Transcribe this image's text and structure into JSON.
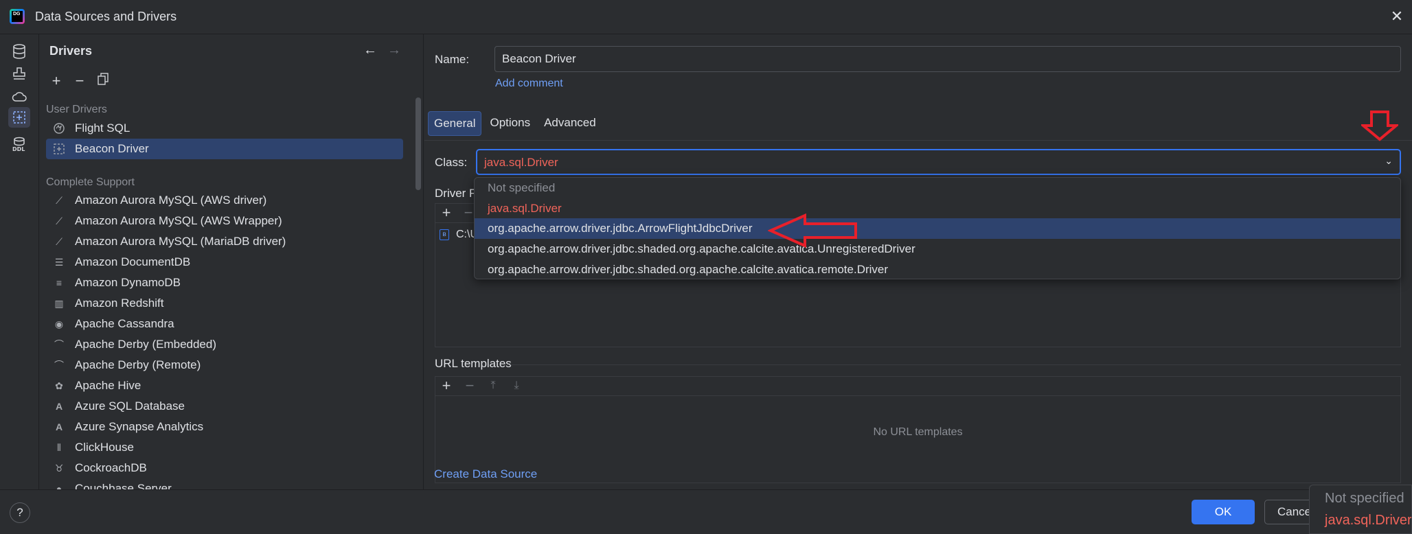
{
  "window": {
    "title": "Data Sources and Drivers"
  },
  "left_panel": {
    "title": "Drivers",
    "groups": [
      {
        "label": "User Drivers"
      },
      {
        "label": "Complete Support"
      }
    ],
    "user_drivers": [
      {
        "label": "Flight SQL",
        "icon": "flight-sql-icon"
      },
      {
        "label": "Beacon Driver",
        "icon": "driver-icon",
        "selected": true
      }
    ],
    "complete_support": [
      {
        "label": "Amazon Aurora MySQL (AWS driver)"
      },
      {
        "label": "Amazon Aurora MySQL (AWS Wrapper)"
      },
      {
        "label": "Amazon Aurora MySQL (MariaDB driver)"
      },
      {
        "label": "Amazon DocumentDB"
      },
      {
        "label": "Amazon DynamoDB"
      },
      {
        "label": "Amazon Redshift"
      },
      {
        "label": "Apache Cassandra"
      },
      {
        "label": "Apache Derby (Embedded)"
      },
      {
        "label": "Apache Derby (Remote)"
      },
      {
        "label": "Apache Hive"
      },
      {
        "label": "Azure SQL Database"
      },
      {
        "label": "Azure Synapse Analytics"
      },
      {
        "label": "ClickHouse"
      },
      {
        "label": "CockroachDB"
      },
      {
        "label": "Couchbase Server"
      }
    ]
  },
  "right": {
    "name_label": "Name:",
    "name_value": "Beacon Driver",
    "add_comment": "Add comment",
    "tabs": [
      "General",
      "Options",
      "Advanced"
    ],
    "active_tab": "General",
    "class_label": "Class:",
    "class_value": "java.sql.Driver",
    "driver_files_label": "Driver F",
    "file_path": "C:\\U",
    "url_templates_label": "URL templates",
    "no_url_templates": "No URL templates",
    "create_data_source": "Create Data Source"
  },
  "dropdown": {
    "options": [
      "Not specified",
      "java.sql.Driver",
      "org.apache.arrow.driver.jdbc.ArrowFlightJdbcDriver",
      "org.apache.arrow.driver.jdbc.shaded.org.apache.calcite.avatica.UnregisteredDriver",
      "org.apache.arrow.driver.jdbc.shaded.org.apache.calcite.avatica.remote.Driver"
    ],
    "highlighted_index": 2
  },
  "footer": {
    "help": "?",
    "ok": "OK",
    "cancel": "Cancel"
  },
  "ghost_popup": {
    "line1": "Not specified",
    "line2": "java.sql.Driver"
  },
  "colors": {
    "accent": "#3574f0",
    "selection": "#2e436e",
    "error_red": "#f0645a",
    "link": "#6f9ff5",
    "annotation_arrow": "#e8202a"
  }
}
